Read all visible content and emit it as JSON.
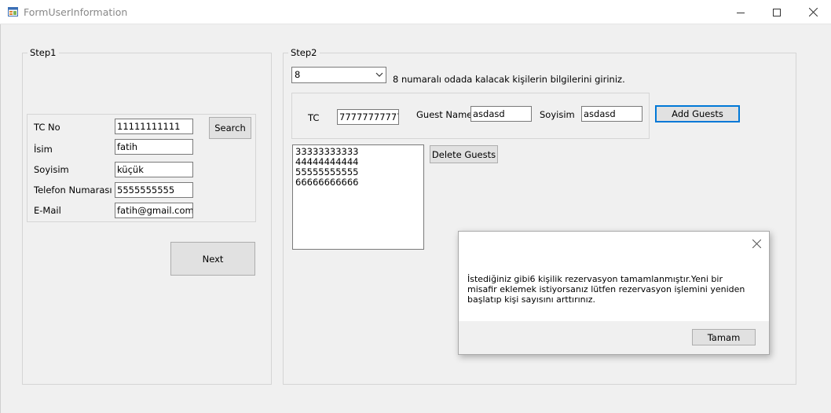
{
  "window": {
    "title": "FormUserInformation",
    "icons": {
      "app": "form-app-icon",
      "minimize": "minimize-icon",
      "maximize": "maximize-icon",
      "close": "close-icon"
    }
  },
  "step1": {
    "legend": "Step1",
    "fields": [
      {
        "label": "TC No",
        "value": "11111111111"
      },
      {
        "label": "İsim",
        "value": "fatih"
      },
      {
        "label": "Soyisim",
        "value": "küçük"
      },
      {
        "label": "Telefon Numarası",
        "value": "5555555555"
      },
      {
        "label": "E-Mail",
        "value": "fatih@gmail.com"
      }
    ],
    "search_label": "Search",
    "next_label": "Next"
  },
  "step2": {
    "legend": "Step2",
    "room_selected": "8",
    "instruction": "8 numaralı odada kalacak kişilerin bilgilerini giriniz.",
    "guest": {
      "tc_label": "TC",
      "tc_value": "77777777777",
      "name_label": "Guest Name",
      "name_value": "asdasd",
      "surname_label": "Soyisim",
      "surname_value": "asdasd",
      "add_label": "Add Guests"
    },
    "guests_list": [
      "33333333333",
      "44444444444",
      "55555555555",
      "66666666666"
    ],
    "delete_label": "Delete Guests"
  },
  "dialog": {
    "message": "İstediğiniz gibi6 kişilik rezervasyon tamamlanmıştır.Yeni bir misafir eklemek istiyorsanız lütfen rezervasyon işlemini yeniden başlatıp kişi sayısını arttırınız.",
    "ok_label": "Tamam"
  },
  "colors": {
    "accent": "#0078d7",
    "window_bg": "#f0f0f0",
    "button_bg": "#e1e1e1"
  }
}
